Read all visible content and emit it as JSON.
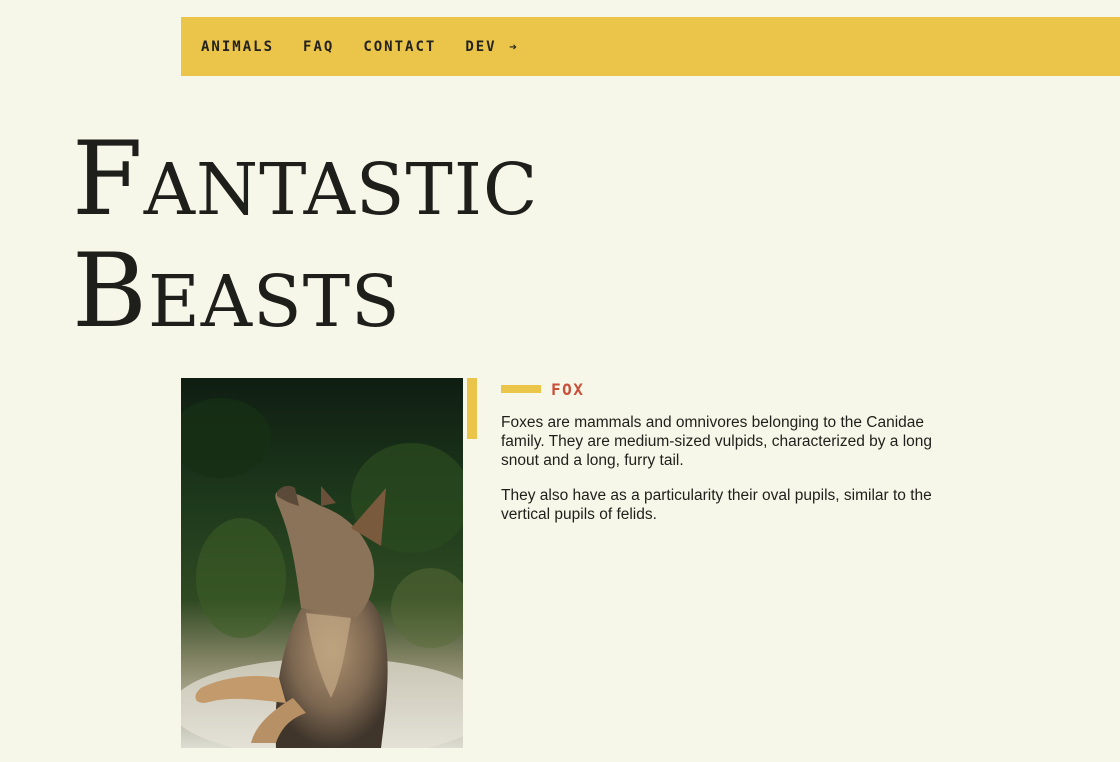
{
  "nav": {
    "items": [
      {
        "label": "ANIMALS"
      },
      {
        "label": "FAQ"
      },
      {
        "label": "CONTACT"
      },
      {
        "label": "DEV",
        "icon": "arrow-right-icon",
        "icon_glyph": "➔"
      }
    ]
  },
  "hero": {
    "title_line1": "Fantastic",
    "title_line2": "Beasts"
  },
  "animal": {
    "image_label": "fox-photo",
    "name": "FOX",
    "paragraphs": [
      "Foxes are mammals and omnivores belonging to the Canidae family. They are medium-sized vulpids, characterized by a long snout and a long, furry tail.",
      "They also have as a particularity their oval pupils, similar to the vertical pupils of felids."
    ]
  },
  "colors": {
    "background": "#f7f7e9",
    "accent": "#ebc44a",
    "title_red": "#c9503a",
    "text": "#1f1f1b"
  }
}
